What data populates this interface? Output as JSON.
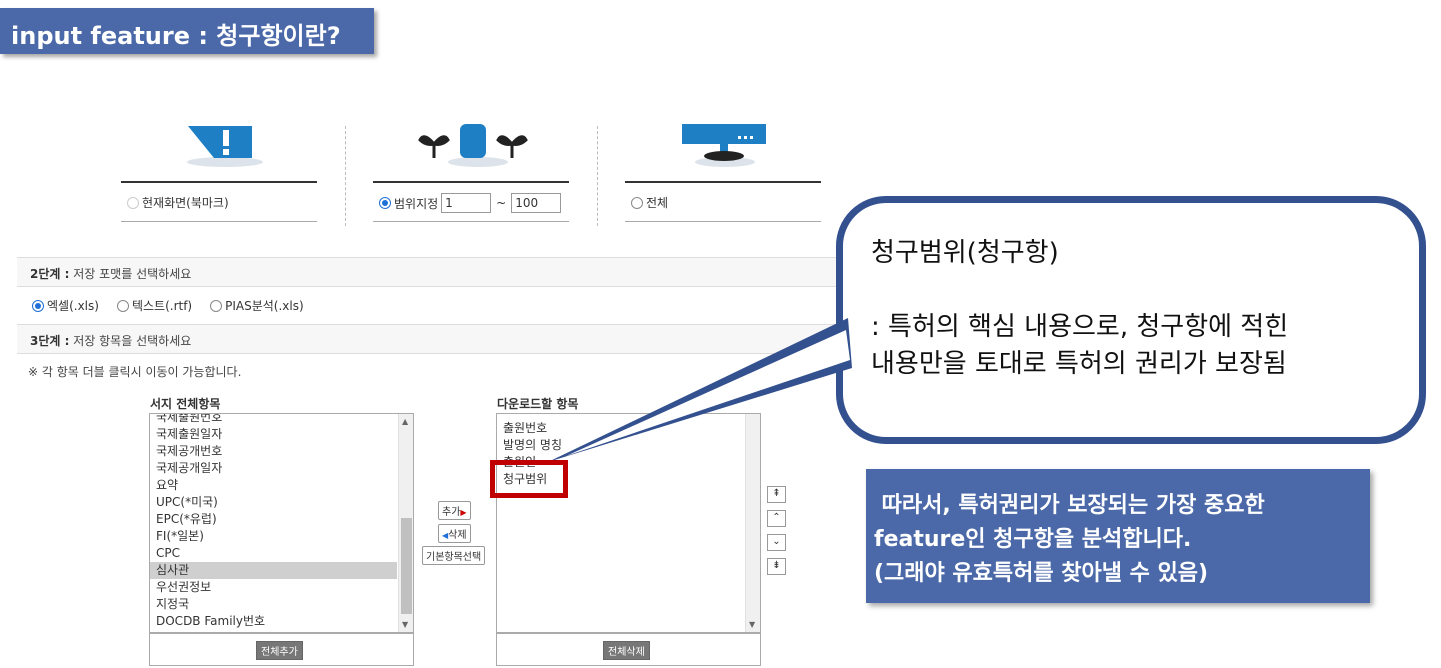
{
  "banner": {
    "title": "input feature : 청구항이란?"
  },
  "step1": {
    "options": [
      {
        "label": "현재화면(북마크)",
        "selected": false,
        "icon": "bookmark-alert-icon"
      },
      {
        "label": "범위지정",
        "selected": true,
        "icon": "plant-range-icon",
        "from": "1",
        "sep": "~",
        "to": "100"
      },
      {
        "label": "전체",
        "selected": false,
        "icon": "monitor-icon"
      }
    ]
  },
  "step2": {
    "label": "2단계 :",
    "text": "저장 포맷를 선택하세요",
    "formats": [
      {
        "label": "엑셀(.xls)",
        "selected": true
      },
      {
        "label": "텍스트(.rtf)",
        "selected": false
      },
      {
        "label": "PIAS분석(.xls)",
        "selected": false
      }
    ]
  },
  "step3": {
    "label": "3단계 :",
    "text": "저장 항목을 선택하세요",
    "note": "※ 각 항목 더블 클릭시 이동이 가능합니다."
  },
  "left_list": {
    "title": "서지 전체항목",
    "items": [
      "국제출원번호",
      "국제출원일자",
      "국제공개번호",
      "국제공개일자",
      "요약",
      "UPC(*미국)",
      "EPC(*유럽)",
      "FI(*일본)",
      "CPC",
      "심사관",
      "우선권정보",
      "지정국",
      "DOCDB Family번호"
    ],
    "selected": "심사관",
    "button": "전체추가"
  },
  "middle_buttons": {
    "add": "추가",
    "remove": "삭제",
    "default": "기본항목선택"
  },
  "right_list": {
    "title": "다운로드할 항목",
    "items": [
      "출원번호",
      "발명의 명칭",
      "출원인",
      "청구범위"
    ],
    "button": "전체삭제"
  },
  "order_buttons": [
    "⇞",
    "⌃",
    "⌄",
    "⇟"
  ],
  "callout": {
    "line1": "청구범위(청구항)",
    "line2": ": 특허의 핵심 내용으로, 청구항에 적힌",
    "line3": "내용만을 토대로 특허의 권리가 보장됨"
  },
  "summary": {
    "line1": " 따라서, 특허권리가 보장되는 가장 중요한",
    "line2": "feature인 청구항을 분석합니다.",
    "line3": "(그래야 유효특허를 찾아낼 수 있음)"
  },
  "colors": {
    "banner": "#4b69a8",
    "icon_blue": "#1f7fc4",
    "callout_border": "#33508f",
    "highlight": "#c00000"
  }
}
